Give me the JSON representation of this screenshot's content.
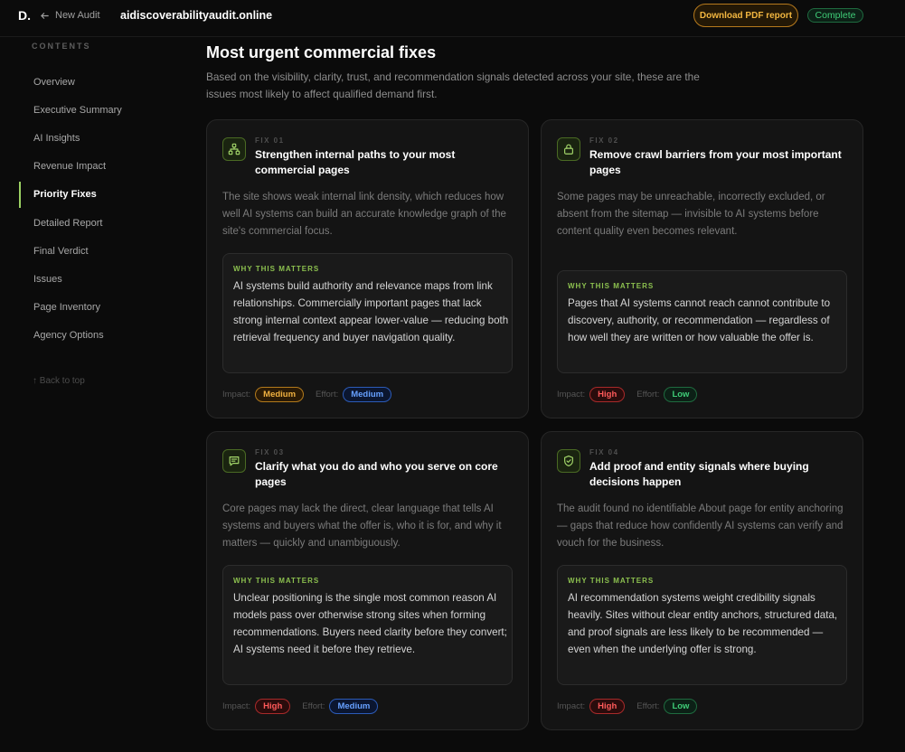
{
  "header": {
    "logo": "D.",
    "back_label": "New Audit",
    "domain": "aidiscoverabilityaudit.online",
    "pdf_button": "Download PDF report",
    "status": "Complete"
  },
  "sidebar": {
    "contents_label": "CONTENTS",
    "items": [
      {
        "label": "Overview"
      },
      {
        "label": "Executive Summary"
      },
      {
        "label": "AI Insights"
      },
      {
        "label": "Revenue Impact"
      },
      {
        "label": "Priority Fixes"
      },
      {
        "label": "Detailed Report"
      },
      {
        "label": "Final Verdict"
      },
      {
        "label": "Issues"
      },
      {
        "label": "Page Inventory"
      },
      {
        "label": "Agency Options"
      }
    ],
    "active_index": 4,
    "back_to_top": "↑ Back to top"
  },
  "main": {
    "title": "Most urgent commercial fixes",
    "subtitle": "Based on the visibility, clarity, trust, and recommendation signals detected across your site, these are the issues most likely to affect qualified demand first.",
    "why_label": "WHY THIS MATTERS",
    "impact_label": "Impact:",
    "effort_label": "Effort:",
    "fixes": [
      {
        "num": "FIX 01",
        "icon": "sitemap-icon",
        "title": "Strengthen internal paths to your most commercial pages",
        "description": "The site shows weak internal link density, which reduces how well AI systems can build an accurate knowledge graph of the site's commercial focus.",
        "why": "AI systems build authority and relevance maps from link relationships. Commercially important pages that lack strong internal context appear lower-value — reducing both retrieval frequency and buyer navigation quality.",
        "impact": "Medium",
        "effort": "Medium"
      },
      {
        "num": "FIX 02",
        "icon": "lock-icon",
        "title": "Remove crawl barriers from your most important pages",
        "description": "Some pages may be unreachable, incorrectly excluded, or absent from the sitemap — invisible to AI systems before content quality even becomes relevant.",
        "why": "Pages that AI systems cannot reach cannot contribute to discovery, authority, or recommendation — regardless of how well they are written or how valuable the offer is.",
        "impact": "High",
        "effort": "Low"
      },
      {
        "num": "FIX 03",
        "icon": "message-icon",
        "title": "Clarify what you do and who you serve on core pages",
        "description": "Core pages may lack the direct, clear language that tells AI systems and buyers what the offer is, who it is for, and why it matters — quickly and unambiguously.",
        "why": "Unclear positioning is the single most common reason AI models pass over otherwise strong sites when forming recommendations. Buyers need clarity before they convert; AI systems need it before they retrieve.",
        "impact": "High",
        "effort": "Medium"
      },
      {
        "num": "FIX 04",
        "icon": "shield-check-icon",
        "title": "Add proof and entity signals where buying decisions happen",
        "description": "The audit found no identifiable About page for entity anchoring — gaps that reduce how confidently AI systems can verify and vouch for the business.",
        "why": "AI recommendation systems weight credibility signals heavily. Sites without clear entity anchors, structured data, and proof signals are less likely to be recommended — even when the underlying offer is strong.",
        "impact": "High",
        "effort": "Low"
      }
    ]
  },
  "colors": {
    "accent": "#9bd163",
    "amber": "#f0b141",
    "red": "#ff5a5a",
    "blue": "#66a0ff",
    "green": "#3fcc77"
  }
}
